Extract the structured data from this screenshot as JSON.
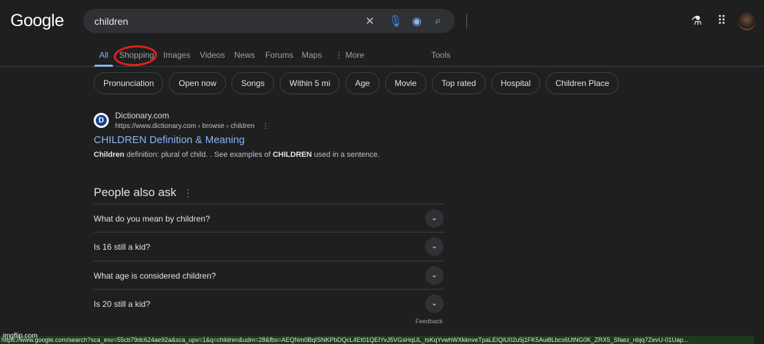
{
  "header": {
    "logo": "Google",
    "query": "children",
    "clear_icon": "close-icon",
    "mic_icon": "microphone-icon",
    "lens_icon": "camera-lens-icon",
    "search_icon": "search-icon",
    "labs_icon": "flask-icon",
    "apps_icon": "grid-icon"
  },
  "tabs": [
    {
      "label": "All",
      "active": true
    },
    {
      "label": "Shopping"
    },
    {
      "label": "Images"
    },
    {
      "label": "Videos"
    },
    {
      "label": "News"
    },
    {
      "label": "Forums"
    },
    {
      "label": "Maps"
    },
    {
      "label": "More"
    }
  ],
  "tools": "Tools",
  "chips": [
    "Pronunciation",
    "Open now",
    "Songs",
    "Within 5 mi",
    "Age",
    "Movie",
    "Top rated",
    "Hospital",
    "Children Place"
  ],
  "result": {
    "site": "Dictionary.com",
    "url": "https://www.dictionary.com › browse › children",
    "title": "CHILDREN Definition & Meaning",
    "snippet_b1": "Children",
    "snippet_1": " definition: plural of child. . See examples of ",
    "snippet_b2": "CHILDREN",
    "snippet_2": " used in a sentence."
  },
  "paa": {
    "heading": "People also ask",
    "questions": [
      "What do you mean by children?",
      "Is 16 still a kid?",
      "What age is considered children?",
      "Is 20 still a kid?"
    ]
  },
  "feedback": "Feedback",
  "status_url": "https://www.google.com/search?sca_esv=55cb79dc624ae92a&sca_upv=1&q=children&udm=28&fbs=AEQNm0BqISNKPbDQcL4Et01QEIYvJ5VGsHqUL_tsKqYvwhWXkknveTpaLEIQiU02u5j1FK5Aui8Lbcs6UtNG0K_ZRX5_Sfaez_nbjq7ZevU-01Uap...",
  "watermark": "imgflip.com",
  "annotation_color": "#e0201c"
}
